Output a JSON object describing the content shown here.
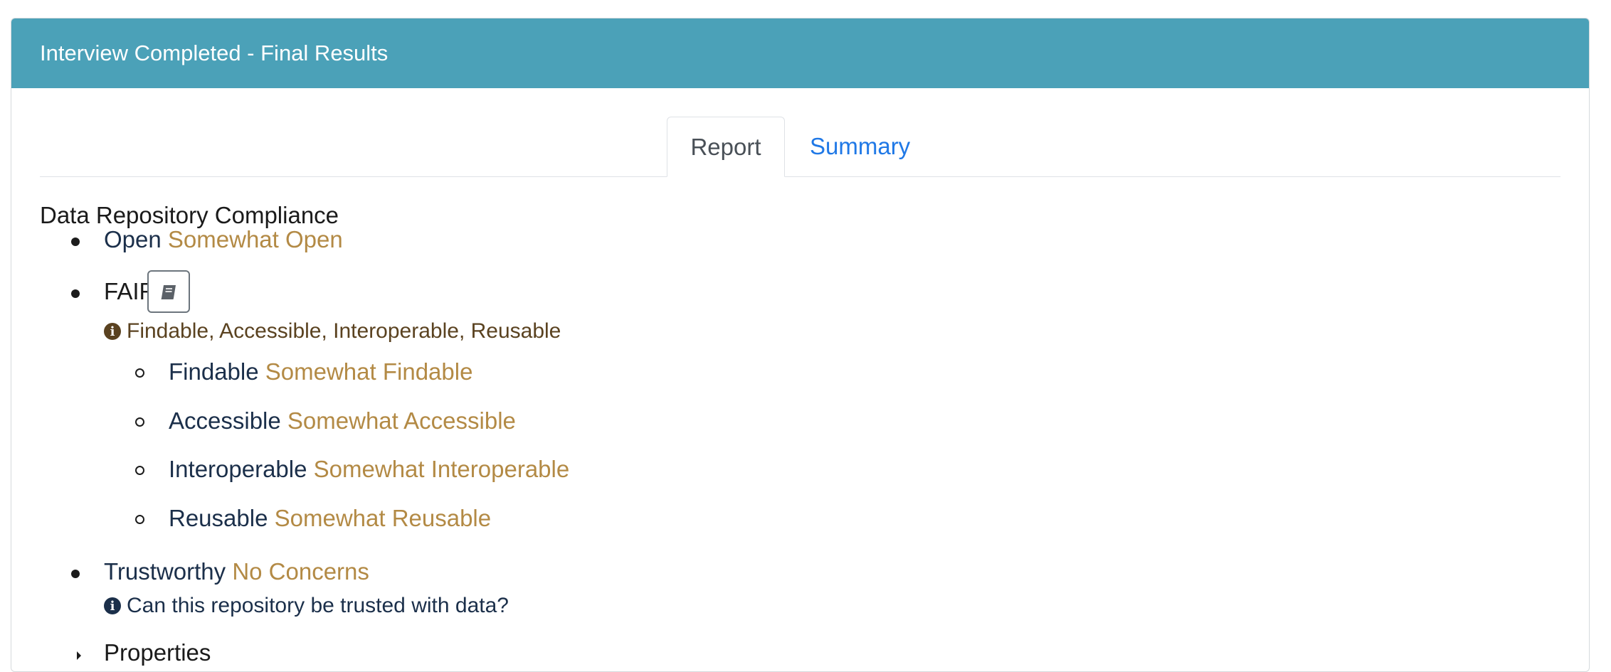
{
  "header": {
    "title": "Interview Completed - Final Results"
  },
  "tabs": [
    {
      "label": "Report",
      "active": true
    },
    {
      "label": "Summary",
      "active": false
    }
  ],
  "section": {
    "title": "Data Repository Compliance"
  },
  "items": {
    "open": {
      "label": "Open",
      "status": "Somewhat Open"
    },
    "fair": {
      "label": "FAIR",
      "button_icon": "book-icon",
      "info": "Findable, Accessible, Interoperable, Reusable",
      "sub": [
        {
          "label": "Findable",
          "status": "Somewhat Findable"
        },
        {
          "label": "Accessible",
          "status": "Somewhat Accessible"
        },
        {
          "label": "Interoperable",
          "status": "Somewhat Interoperable"
        },
        {
          "label": "Reusable",
          "status": "Somewhat Reusable"
        }
      ]
    },
    "trustworthy": {
      "label": "Trustworthy",
      "status": "No Concerns",
      "info": "Can this repository be trusted with data?"
    },
    "properties": {
      "label": "Properties"
    }
  },
  "colors": {
    "header_bg": "#4ba1b8",
    "status": "#b38a45",
    "link": "#1f78e6",
    "fair_info": "#5a4220",
    "trust_info": "#1b2f4a"
  }
}
